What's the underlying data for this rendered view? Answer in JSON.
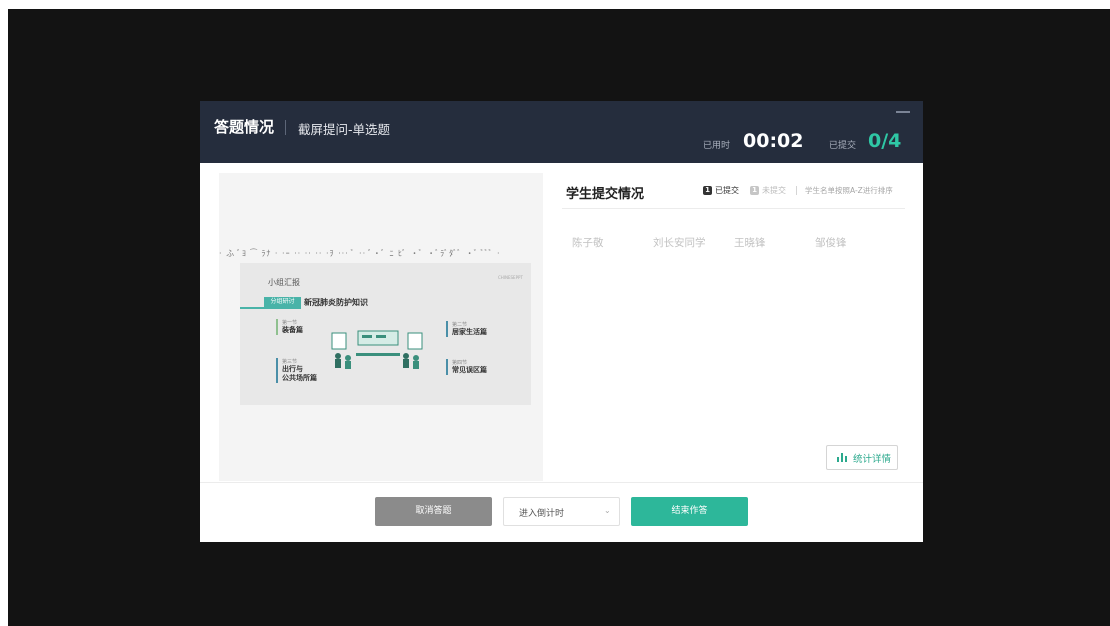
{
  "header": {
    "title": "答题情况",
    "subtitle": "截屏提问-单选题",
    "elapsed_label": "已用时",
    "elapsed_value": "00:02",
    "submitted_label": "已提交",
    "submitted_value": "0/4"
  },
  "preview": {
    "strip_text": "· ふ ﾞﾖ ⁀ ﾗﾅ  · ·ｰ ·· ·· ·· ·ｦ ···  ﾞ ·· ﾞ·ﾞ  ﾆ ﾋﾞ  ·ﾞ ·ﾞﾗﾞﾀﾞﾞ ·ﾞ  ﾞﾞﾞ ·",
    "slide": {
      "title": "小组汇报",
      "corner_mark": "CHINESEPPT",
      "tag": "分组研讨",
      "topic": "新冠肺炎防护知识",
      "items": [
        {
          "num": "第一节",
          "title": "装备篇"
        },
        {
          "num": "第三节",
          "title": "出行与",
          "title2": "公共场所篇"
        },
        {
          "num": "第二节",
          "title": "居家生活篇"
        },
        {
          "num": "第四节",
          "title": "常见误区篇"
        }
      ]
    }
  },
  "submissions": {
    "title": "学生提交情况",
    "legend_submitted": "已提交",
    "legend_not_submitted": "未提交",
    "sort_note": "学生名单按照A-Z进行排序",
    "students": [
      "陈子敬",
      "刘长安同学",
      "王晓锋",
      "邹俊锋"
    ],
    "stats_button": "统计详情"
  },
  "footer": {
    "cancel_button": "取消答题",
    "countdown_select": "进入倒计时",
    "end_button": "结束作答"
  },
  "colors": {
    "accent": "#2db79a",
    "header_bg": "#252d3d",
    "backdrop": "#131313"
  }
}
